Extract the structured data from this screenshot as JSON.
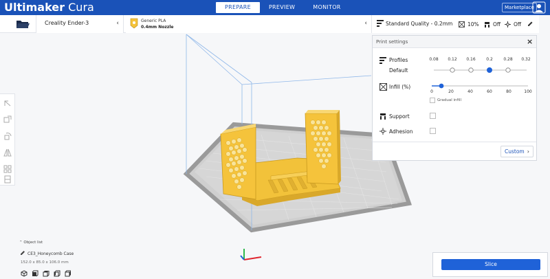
{
  "app": {
    "brand_main": "Ultimaker",
    "brand_sub": "Cura"
  },
  "nav": {
    "tabs": [
      "PREPARE",
      "PREVIEW",
      "MONITOR"
    ],
    "active": "PREPARE"
  },
  "header": {
    "marketplace": "Marketplace"
  },
  "printer": {
    "name": "Creality Ender-3"
  },
  "material": {
    "name": "Generic PLA",
    "nozzle": "0.4mm Nozzle"
  },
  "quality": {
    "profile": "Standard Quality - 0.2mm",
    "infill": "10%",
    "support": "Off",
    "adhesion": "Off"
  },
  "print_settings": {
    "title": "Print settings",
    "profiles_label": "Profiles",
    "default_label": "Default",
    "profile_ticks": [
      "0.08",
      "0.12",
      "0.16",
      "0.2",
      "0.28",
      "0.32"
    ],
    "selected_profile": "0.2",
    "infill_label": "Infill (%)",
    "infill_ticks": [
      "0",
      "20",
      "40",
      "60",
      "80",
      "100"
    ],
    "infill_value": 10,
    "gradual_infill": "Gradual infill",
    "support_label": "Support",
    "adhesion_label": "Adhesion",
    "custom_button": "Custom"
  },
  "object": {
    "list_label": "Object list",
    "name": "CE3_Honeycomb Case",
    "dimensions": "152.0 x 85.0 x 106.0 mm"
  },
  "slice": {
    "button": "Slice"
  },
  "colors": {
    "topbar": "#1a52b8",
    "accent": "#1f62d8",
    "model": "#f5c33b",
    "build_plate": "#c8c8c8",
    "build_border": "#a9a9a9"
  },
  "icons": [
    "folder-icon",
    "material-icon",
    "quality-icon",
    "infill-icon",
    "support-icon",
    "adhesion-icon",
    "edit-icon",
    "close-icon",
    "chevron-left-icon",
    "chevron-right-icon",
    "move-icon",
    "scale-icon",
    "rotate-icon",
    "mirror-icon",
    "per-model-settings-icon",
    "support-blocker-icon",
    "pencil-icon",
    "view-3d-icon",
    "view-front-icon",
    "view-top-icon",
    "view-left-icon",
    "view-right-icon"
  ]
}
